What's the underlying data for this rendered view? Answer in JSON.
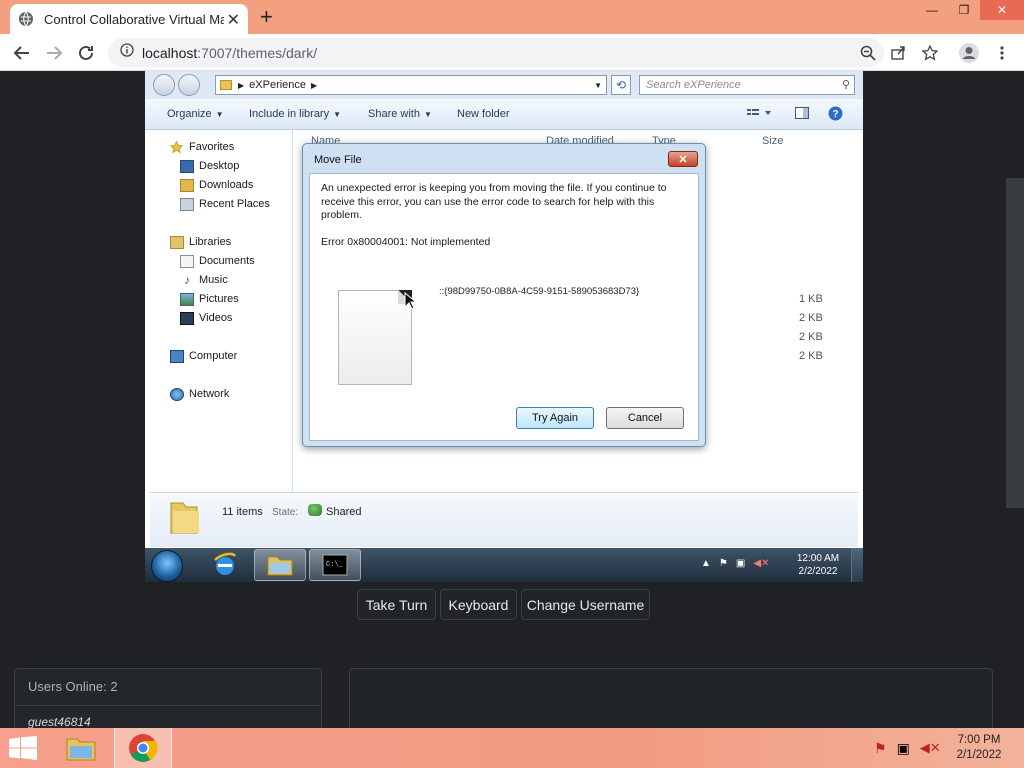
{
  "browser": {
    "tab_title": "Control Collaborative Virtual Ma",
    "url_host": "localhost",
    "url_rest": ":7007/themes/dark/"
  },
  "explorer": {
    "breadcrumb": "eXPerience",
    "search_placeholder": "Search eXPerience",
    "toolbar": {
      "organize": "Organize",
      "include_in_library": "Include in library",
      "share_with": "Share with",
      "new_folder": "New folder"
    },
    "nav": {
      "favorites": "Favorites",
      "desktop": "Desktop",
      "downloads": "Downloads",
      "recent_places": "Recent Places",
      "libraries": "Libraries",
      "documents": "Documents",
      "music": "Music",
      "pictures": "Pictures",
      "videos": "Videos",
      "computer": "Computer",
      "network": "Network"
    },
    "columns": {
      "name": "Name",
      "date_modified": "Date modified",
      "type": "Type",
      "size": "Size"
    },
    "sizes": [
      "1 KB",
      "2 KB",
      "2 KB",
      "2 KB"
    ],
    "details": {
      "item_count": "11 items",
      "state_label": "State:",
      "state_value": "Shared"
    }
  },
  "dialog": {
    "title": "Move File",
    "message": "An unexpected error is keeping you from moving the file. If you continue to receive this error, you can use the error code to search for help with this problem.",
    "error": "Error 0x80004001: Not implemented",
    "file_name": "::{98D99750-0B8A-4C59-9151-589053683D73}",
    "try_again": "Try Again",
    "cancel": "Cancel"
  },
  "vm_taskbar": {
    "time": "12:00 AM",
    "date": "2/2/2022"
  },
  "controls": {
    "take_turn": "Take Turn",
    "keyboard": "Keyboard",
    "change_username": "Change Username"
  },
  "users": {
    "header": "Users Online: 2",
    "list": [
      "guest46814"
    ]
  },
  "host_taskbar": {
    "time": "7:00 PM",
    "date": "2/1/2022"
  }
}
